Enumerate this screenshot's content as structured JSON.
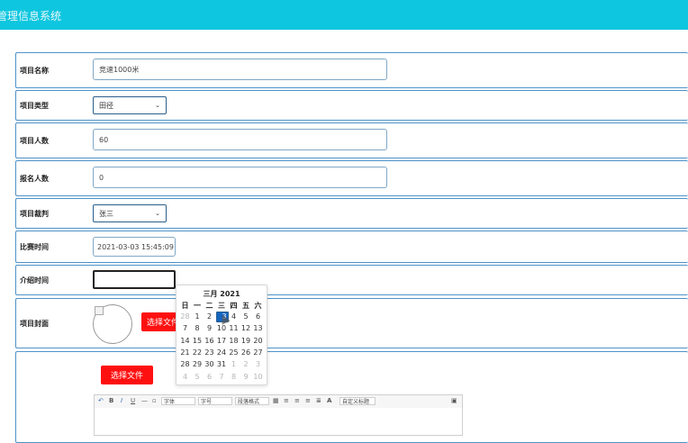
{
  "header": {
    "title": "管理信息系统"
  },
  "form": {
    "name": {
      "label": "项目名称",
      "value": "竞速1000米"
    },
    "type": {
      "label": "项目类型",
      "value": "田径"
    },
    "count": {
      "label": "项目人数",
      "value": "60"
    },
    "enrolled": {
      "label": "报名人数",
      "value": "0"
    },
    "referee": {
      "label": "项目裁判",
      "value": "张三"
    },
    "match_time": {
      "label": "比赛时间",
      "value": "2021-03-03 15:45:09"
    },
    "intro_time": {
      "label": "介绍时间",
      "value": ""
    },
    "cover": {
      "label": "项目封面",
      "button": "选择文件"
    },
    "content": {
      "button": "选择文件"
    }
  },
  "calendar": {
    "title": "三月 2021",
    "weekdays": [
      "日",
      "一",
      "二",
      "三",
      "四",
      "五",
      "六"
    ],
    "rows": [
      [
        "28",
        "1",
        "2",
        "3",
        "4",
        "5",
        "6"
      ],
      [
        "7",
        "8",
        "9",
        "10",
        "11",
        "12",
        "13"
      ],
      [
        "14",
        "15",
        "16",
        "17",
        "18",
        "19",
        "20"
      ],
      [
        "21",
        "22",
        "23",
        "24",
        "25",
        "26",
        "27"
      ],
      [
        "28",
        "29",
        "30",
        "31",
        "1",
        "2",
        "3"
      ],
      [
        "4",
        "5",
        "6",
        "7",
        "8",
        "9",
        "10"
      ]
    ],
    "selected": "3"
  },
  "editor_toolbar": {
    "font": "字体",
    "size": "字号",
    "para": "段落格式",
    "custom": "自定义标题",
    "bold": "B",
    "italic": "I",
    "underline": "U",
    "fontcolor": "A"
  }
}
